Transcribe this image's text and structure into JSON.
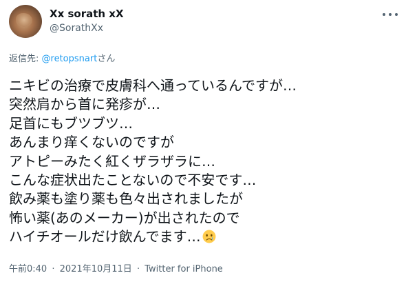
{
  "author": {
    "display_name": "Xx sorath xX",
    "handle": "@SorathXx"
  },
  "reply": {
    "prefix": "返信先:",
    "mention": "@retopsnart",
    "suffix": "さん"
  },
  "tweet": {
    "lines": [
      "ニキビの治療で皮膚科へ通っているんですが…",
      "突然肩から首に発疹が…",
      "足首にもブツブツ…",
      "あんまり痒くないのですが",
      "アトピーみたく紅くザラザラに…",
      "こんな症状出たことないので不安です…",
      "飲み薬も塗り薬も色々出されましたが",
      "怖い薬(あのメーカー)が出されたので",
      "ハイチオールだけ飲んでます…"
    ],
    "emoji": "crying-face"
  },
  "meta": {
    "time": "午前0:40",
    "date": "2021年10月11日",
    "source": "Twitter for iPhone",
    "separator": "·"
  },
  "colors": {
    "text": "#0f1419",
    "secondary": "#536471",
    "link": "#1d9bf0"
  }
}
